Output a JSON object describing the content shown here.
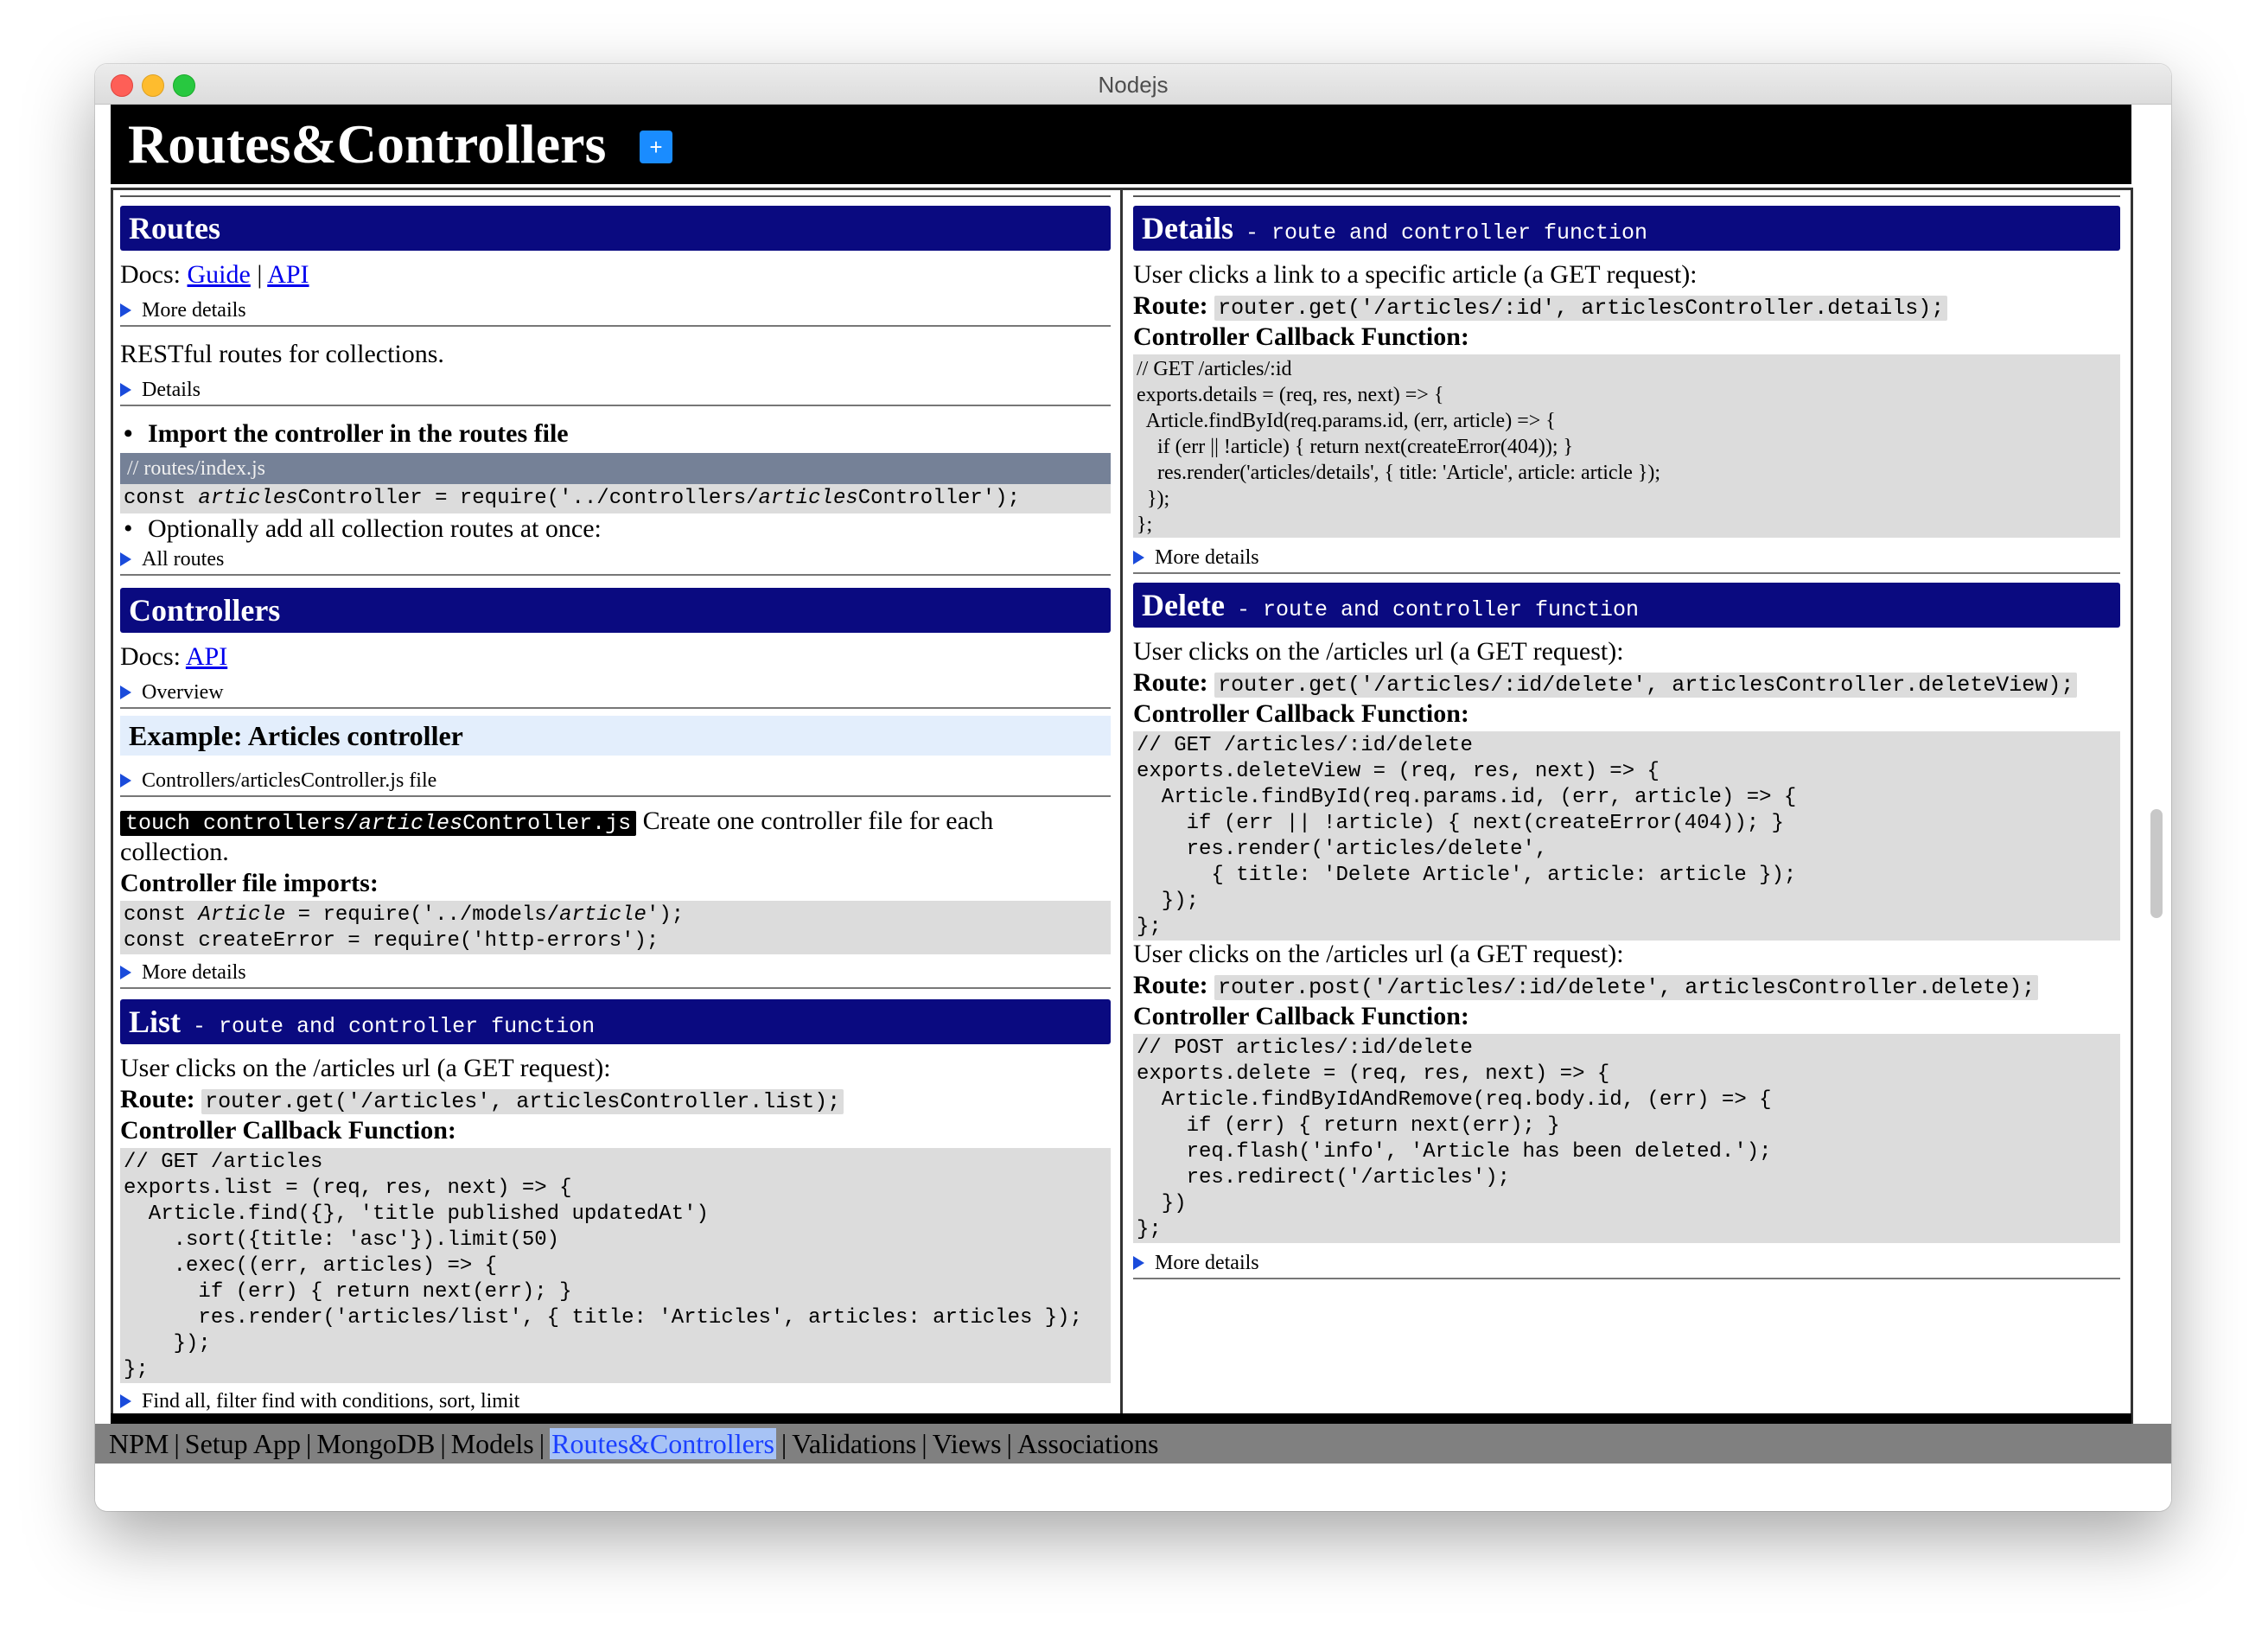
{
  "window": {
    "title": "Nodejs"
  },
  "header": {
    "title": "Routes&Controllers",
    "plus": "+"
  },
  "left": {
    "routes": {
      "title": "Routes",
      "docs_label": "Docs:",
      "guide_link": "Guide",
      "sep": "|",
      "api_link": "API",
      "more_details": "More details",
      "restful": "RESTful routes for collections.",
      "details": "Details",
      "bullet1": "Import the controller in the routes file",
      "routes_file": "// routes/index.js",
      "bullet2": "Optionally add all collection routes at once:",
      "all_routes": "All routes"
    },
    "controllers": {
      "title": "Controllers",
      "docs_label": "Docs:",
      "api_link": "API",
      "overview": "Overview",
      "example": "Example: Articles controller",
      "file_details": "Controllers/articlesController.js file",
      "touch_cmd_pre": "touch controllers/",
      "touch_cmd_em": "articles",
      "touch_cmd_post": "Controller.js",
      "create_text_1": "Create one controller file for each",
      "create_text_2": "collection.",
      "imports_label": "Controller file imports:",
      "more_details": "More details"
    },
    "list": {
      "title": "List",
      "subtitle": "- route and controller function",
      "user_text": "User clicks on the /articles url (a GET request):",
      "route_label": "Route:",
      "route_code": "router.get('/articles', articlesController.list);",
      "callback_label": "Controller Callback Function:",
      "code": "// GET /articles\nexports.list = (req, res, next) => {\n  Article.find({}, 'title published updatedAt')\n    .sort({title: 'asc'}).limit(50)\n    .exec((err, articles) => {\n      if (err) { return next(err); }\n      res.render('articles/list', { title: 'Articles', articles: articles });\n    });\n};",
      "find_details": "Find all, filter find with conditions, sort, limit"
    }
  },
  "right": {
    "details": {
      "title": "Details",
      "subtitle": "- route and controller function",
      "user_text": "User clicks a link to a specific article (a GET request):",
      "route_label": "Route:",
      "route_code": "router.get('/articles/:id', articlesController.details);",
      "callback_label": "Controller Callback Function:",
      "code": "// GET /articles/:id\nexports.details = (req, res, next) => {\n  Article.findById(req.params.id, (err, article) => {\n    if (err || !article) { return next(createError(404)); }\n    res.render('articles/details', { title: 'Article', article: article });\n  });\n};",
      "more_details": "More details"
    },
    "delete": {
      "title": "Delete",
      "subtitle": "- route and controller function",
      "user_text_1": "User clicks on the /articles url (a GET request):",
      "route_label": "Route:",
      "route_code_1": "router.get('/articles/:id/delete', articlesController.deleteView);",
      "callback_label": "Controller Callback Function:",
      "code_1": "// GET /articles/:id/delete\nexports.deleteView = (req, res, next) => {\n  Article.findById(req.params.id, (err, article) => {\n    if (err || !article) { next(createError(404)); }\n    res.render('articles/delete',\n      { title: 'Delete Article', article: article });\n  });\n};",
      "user_text_2": "User clicks on the /articles url (a GET request):",
      "route_code_2": "router.post('/articles/:id/delete', articlesController.delete);",
      "code_2": "// POST articles/:id/delete\nexports.delete = (req, res, next) => {\n  Article.findByIdAndRemove(req.body.id, (err) => {\n    if (err) { return next(err); }\n    req.flash('info', 'Article has been deleted.');\n    res.redirect('/articles');\n  })\n};",
      "more_details": "More details"
    }
  },
  "nav": {
    "sep": "|",
    "items": [
      "NPM",
      "Setup App",
      "MongoDB",
      "Models",
      "Routes&Controllers",
      "Validations",
      "Views",
      "Associations"
    ]
  }
}
